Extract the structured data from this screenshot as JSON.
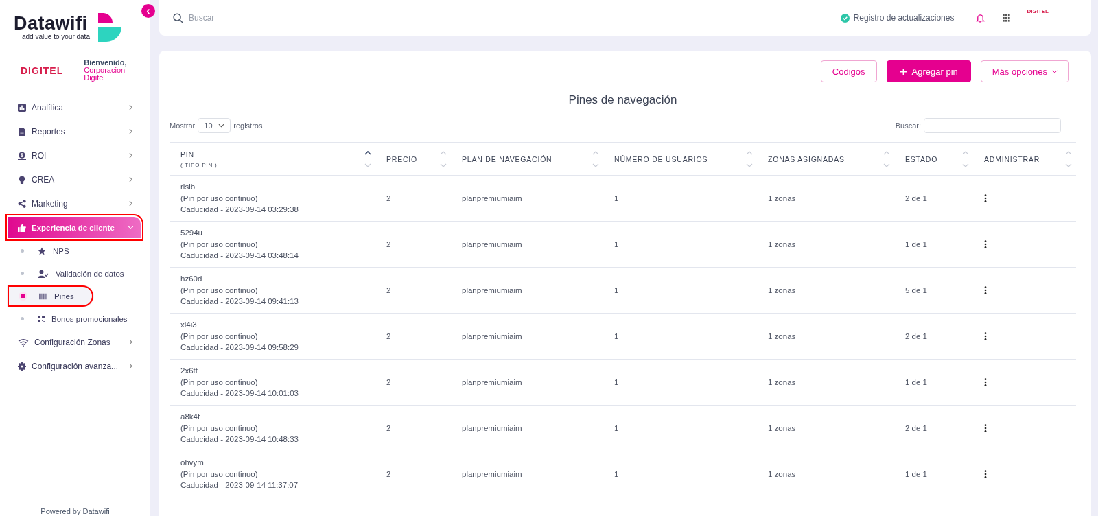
{
  "sidebar": {
    "brand": {
      "name": "Datawifi",
      "tagline": "add value to your data"
    },
    "collapse_button": "‹",
    "client": {
      "logo": "DIGITEL",
      "greeting": "Bienvenido,",
      "name": "Corporacion Digitel"
    },
    "items": [
      {
        "label": "Analítica",
        "expanded": false,
        "annotated": false
      },
      {
        "label": "Reportes",
        "expanded": false,
        "annotated": false
      },
      {
        "label": "ROI",
        "expanded": false,
        "annotated": false
      },
      {
        "label": "CREA",
        "expanded": false,
        "annotated": false
      },
      {
        "label": "Marketing",
        "expanded": false,
        "annotated": false
      },
      {
        "label": "Experiencia de cliente",
        "expanded": true,
        "annotated": true,
        "children": [
          {
            "label": "NPS",
            "selected": false,
            "annotated": false
          },
          {
            "label": "Validación de datos",
            "selected": false,
            "annotated": false
          },
          {
            "label": "Pines",
            "selected": true,
            "annotated": true
          },
          {
            "label": "Bonos promocionales",
            "selected": false,
            "annotated": false
          }
        ]
      },
      {
        "label": "Configuración Zonas",
        "expanded": false,
        "annotated": false
      },
      {
        "label": "Configuración avanza...",
        "expanded": false,
        "annotated": false
      }
    ],
    "footer": "Powered by Datawifi"
  },
  "topbar": {
    "search": {
      "placeholder": "Buscar"
    },
    "changelog": "Registro de actualizaciones",
    "account_logo": "DIGITEL"
  },
  "toolbar": {
    "buttons": [
      {
        "label": "Códigos",
        "kind": "outline"
      },
      {
        "label": "Agregar pin",
        "kind": "primary"
      },
      {
        "label": "Más opciones",
        "kind": "dropdown"
      }
    ]
  },
  "page_title": "Pines de navegación",
  "length_menu": {
    "before": "Mostrar",
    "value": "10",
    "after": "registros"
  },
  "filter": {
    "label": "Buscar:"
  },
  "table": {
    "columns": [
      {
        "label": "PIN",
        "sublabel": "( TIPO PIN )",
        "sorted": true
      },
      {
        "label": "PRECIO",
        "sorted": false
      },
      {
        "label": "PLAN DE NAVEGACIÓN",
        "sorted": false
      },
      {
        "label": "NÚMERO DE USUARIOS",
        "sorted": false
      },
      {
        "label": "ZONAS ASIGNADAS",
        "sorted": false
      },
      {
        "label": "ESTADO",
        "sorted": false
      },
      {
        "label": "ADMINISTRAR",
        "sorted": false
      }
    ],
    "rows": [
      {
        "pin": "rlslb",
        "type": "(Pin por uso continuo)",
        "expiry": "Caducidad - 2023-09-14 03:29:38",
        "price": "2",
        "plan": "planpremiumiaim",
        "users": "1",
        "zones": "1 zonas",
        "status": "2 de 1"
      },
      {
        "pin": "5294u",
        "type": "(Pin por uso continuo)",
        "expiry": "Caducidad - 2023-09-14 03:48:14",
        "price": "2",
        "plan": "planpremiumiaim",
        "users": "1",
        "zones": "1 zonas",
        "status": "1 de 1"
      },
      {
        "pin": "hz60d",
        "type": "(Pin por uso continuo)",
        "expiry": "Caducidad - 2023-09-14 09:41:13",
        "price": "2",
        "plan": "planpremiumiaim",
        "users": "1",
        "zones": "1 zonas",
        "status": "5 de 1"
      },
      {
        "pin": "xl4i3",
        "type": "(Pin por uso continuo)",
        "expiry": "Caducidad - 2023-09-14 09:58:29",
        "price": "2",
        "plan": "planpremiumiaim",
        "users": "1",
        "zones": "1 zonas",
        "status": "2 de 1"
      },
      {
        "pin": "2x6tt",
        "type": "(Pin por uso continuo)",
        "expiry": "Caducidad - 2023-09-14 10:01:03",
        "price": "2",
        "plan": "planpremiumiaim",
        "users": "1",
        "zones": "1 zonas",
        "status": "1 de 1"
      },
      {
        "pin": "a8k4t",
        "type": "(Pin por uso continuo)",
        "expiry": "Caducidad - 2023-09-14 10:48:33",
        "price": "2",
        "plan": "planpremiumiaim",
        "users": "1",
        "zones": "1 zonas",
        "status": "2 de 1"
      },
      {
        "pin": "ohvym",
        "type": "(Pin por uso continuo)",
        "expiry": "Caducidad - 2023-09-14 11:37:07",
        "price": "2",
        "plan": "planpremiumiaim",
        "users": "1",
        "zones": "1 zonas",
        "status": "1 de 1"
      }
    ]
  }
}
